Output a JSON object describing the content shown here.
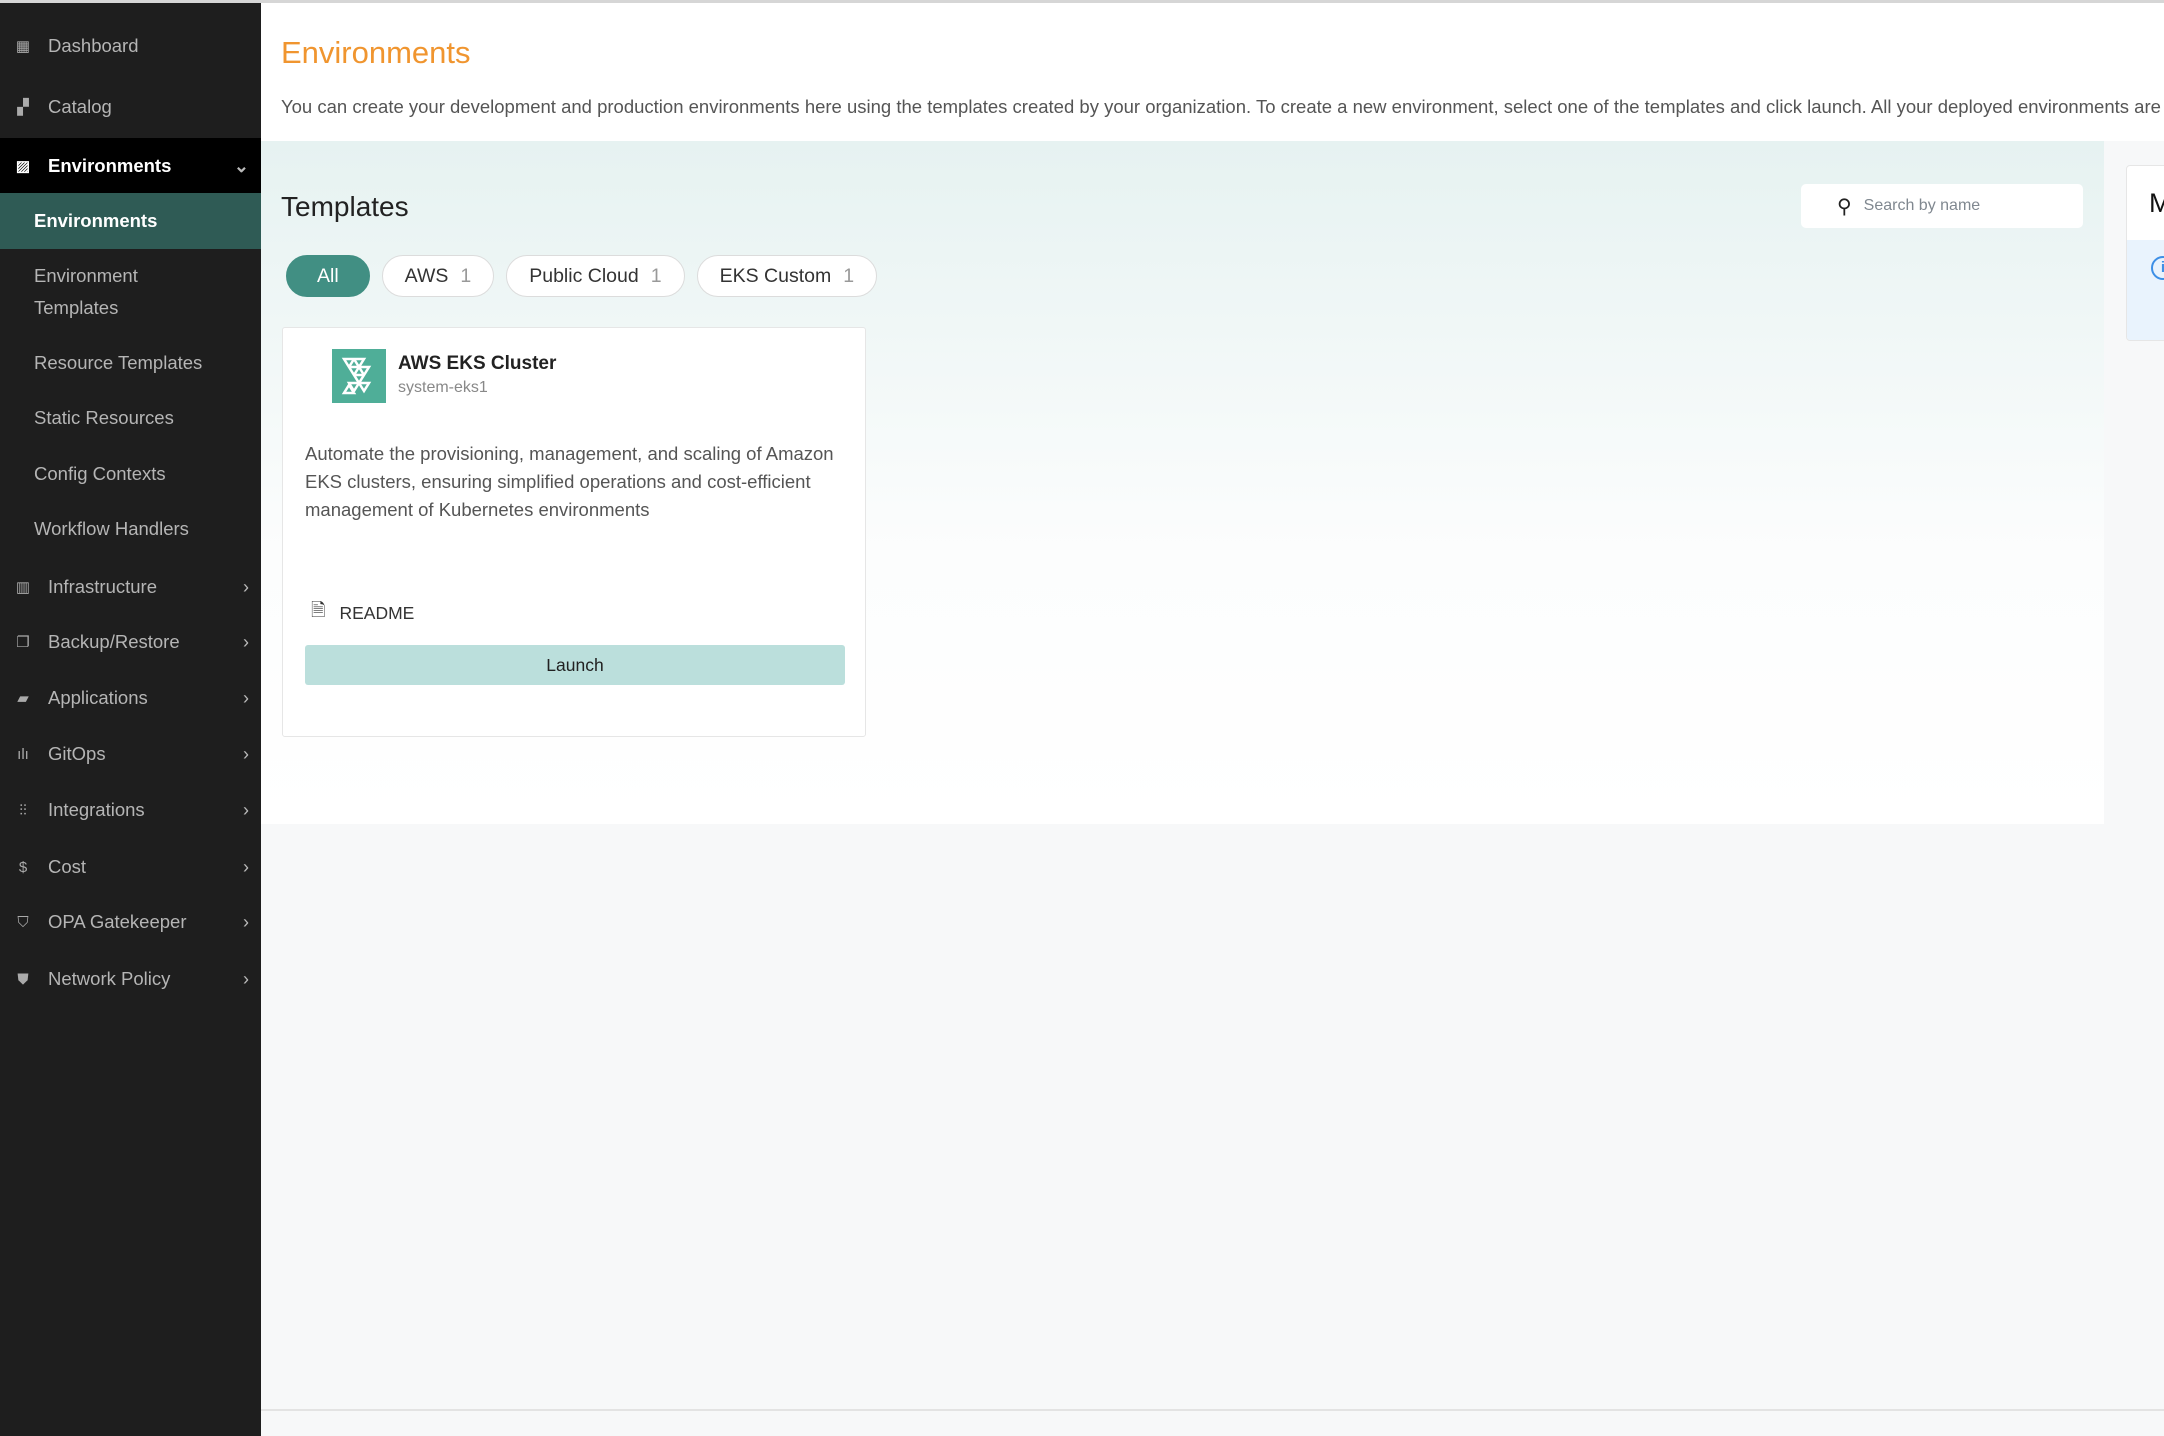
{
  "sidebar": {
    "items": [
      {
        "label": "Dashboard",
        "icon": "dashboard-icon"
      },
      {
        "label": "Catalog",
        "icon": "catalog-icon"
      },
      {
        "label": "Environments",
        "icon": "image-icon",
        "expanded": true
      },
      {
        "label": "Infrastructure",
        "icon": "building-icon"
      },
      {
        "label": "Backup/Restore",
        "icon": "copy-icon"
      },
      {
        "label": "Applications",
        "icon": "briefcase-icon"
      },
      {
        "label": "GitOps",
        "icon": "waveform-icon"
      },
      {
        "label": "Integrations",
        "icon": "sliders-icon"
      },
      {
        "label": "Cost",
        "icon": "dollar-icon"
      },
      {
        "label": "OPA Gatekeeper",
        "icon": "shield-icon"
      },
      {
        "label": "Network Policy",
        "icon": "shield-check-icon"
      }
    ],
    "sub_items": [
      {
        "label": "Environments",
        "active": true
      },
      {
        "label": "Environment Templates"
      },
      {
        "label": "Resource Templates"
      },
      {
        "label": "Static Resources"
      },
      {
        "label": "Config Contexts"
      },
      {
        "label": "Workflow Handlers"
      }
    ]
  },
  "header": {
    "title": "Environments",
    "description": "You can create your development and production environments here using the templates created by your organization. To create a new environment, select one of the templates and click launch. All your deployed environments are"
  },
  "templates": {
    "title": "Templates",
    "search_placeholder": "Search by name",
    "chips": [
      {
        "label": "All",
        "count": "",
        "active": true
      },
      {
        "label": "AWS",
        "count": "1"
      },
      {
        "label": "Public Cloud",
        "count": "1"
      },
      {
        "label": "EKS Custom",
        "count": "1"
      }
    ],
    "card": {
      "name": "AWS EKS Cluster",
      "id": "system-eks1",
      "description": "Automate the provisioning, management, and scaling of Amazon EKS clusters, ensuring simplified operations and cost-efficient management of Kubernetes environments",
      "readme_label": "README",
      "launch_label": "Launch"
    }
  },
  "right_card": {
    "title_partial": "M"
  },
  "colors": {
    "accent": "#f0952f",
    "primary": "#418f83",
    "active_sub": "#2f5b55",
    "sidebar_bg": "#1e1e1e"
  }
}
